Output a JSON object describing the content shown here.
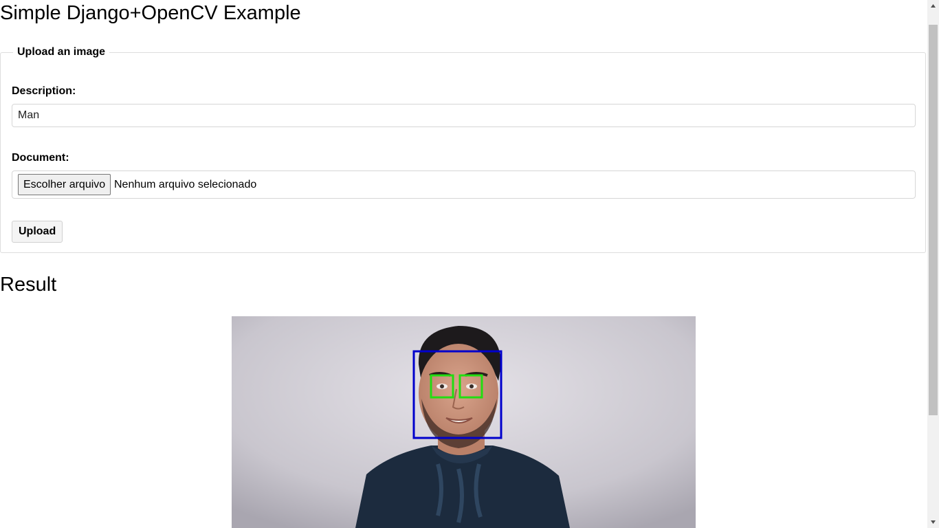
{
  "page": {
    "title": "Simple Django+OpenCV Example"
  },
  "upload_form": {
    "legend": "Upload an image",
    "description_label": "Description:",
    "description_value": "Man",
    "document_label": "Document:",
    "file_button_label": "Escolher arquivo",
    "file_status": "Nenhum arquivo selecionado",
    "submit_label": "Upload"
  },
  "result": {
    "heading": "Result",
    "image_description": "Photo of a smiling man in a dark knit sweater; detected face outlined in blue and both eyes outlined in green"
  },
  "colors": {
    "face_box": "#0000cc",
    "eye_box": "#22dd11",
    "scroll_thumb": "#c1c1c1"
  },
  "icons": {
    "scroll_up": "triangle-up-icon",
    "scroll_down": "triangle-down-icon"
  }
}
